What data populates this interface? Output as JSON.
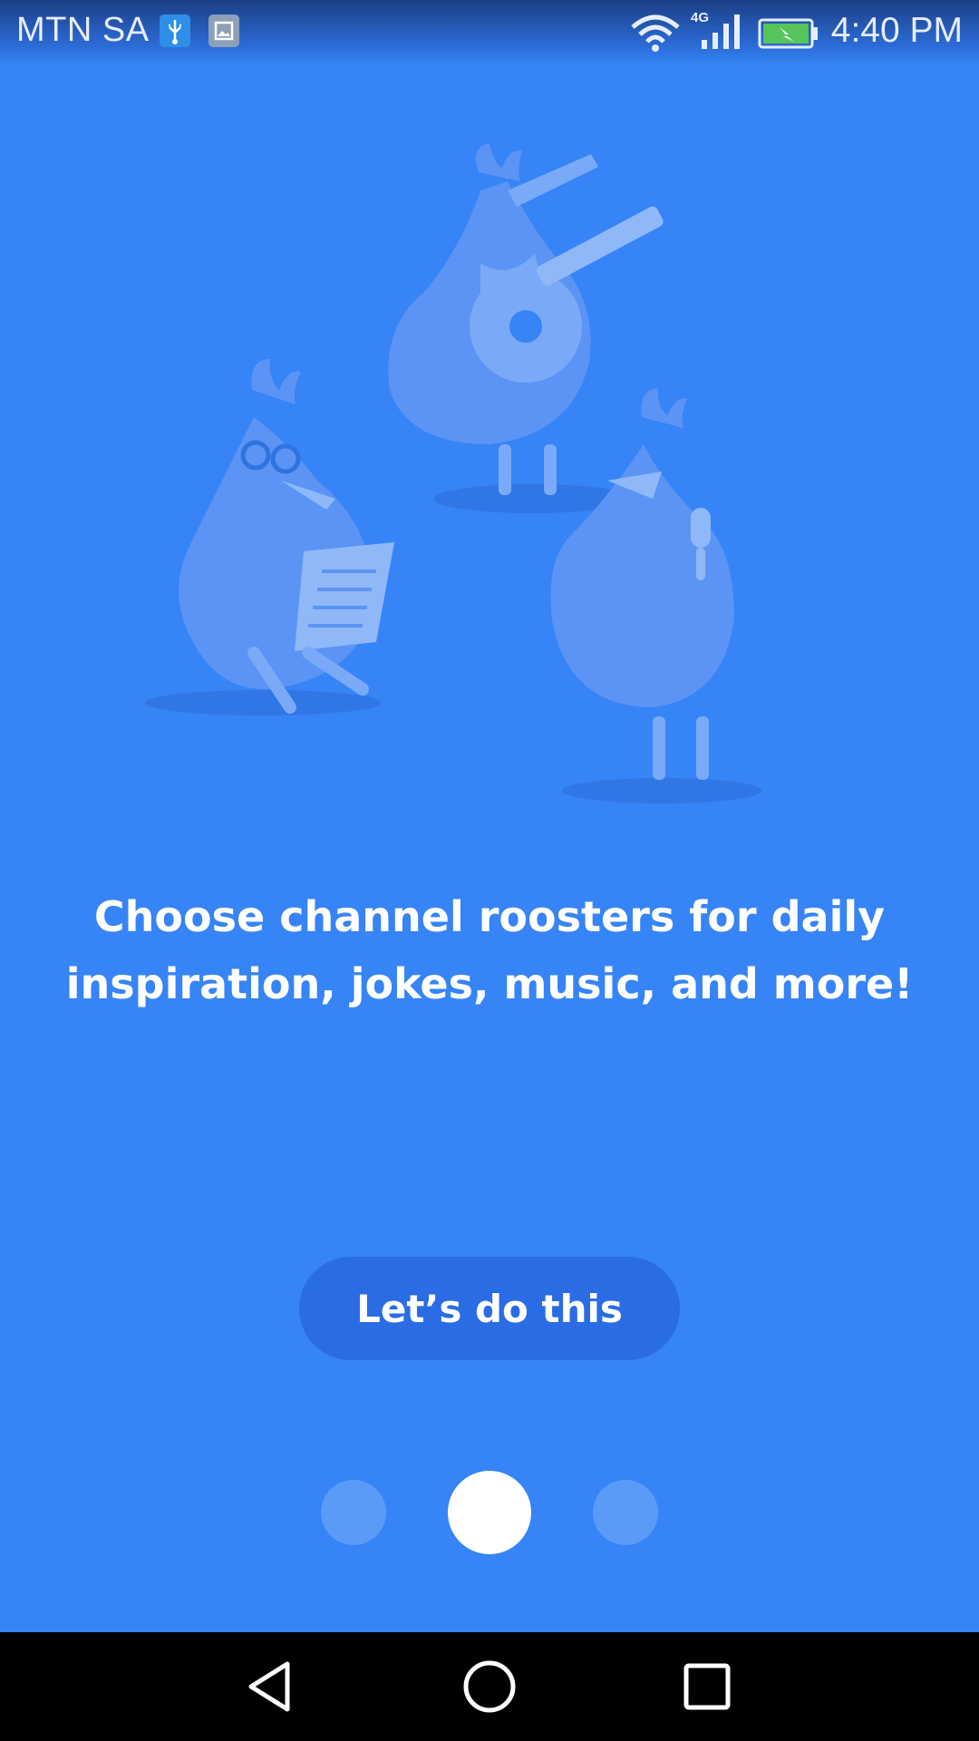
{
  "status_bar": {
    "carrier": "MTN SA",
    "network_type": "4G",
    "time": "4:40 PM",
    "icons": [
      "usb-icon",
      "gallery-icon",
      "wifi-icon",
      "signal-icon",
      "battery-charging-icon"
    ]
  },
  "onboarding": {
    "illustration": "roosters-illustration",
    "headline": "Choose channel roosters for daily inspiration, jokes, music, and more!",
    "cta_label": "Let’s do this",
    "pager": {
      "total": 3,
      "active": 2
    }
  },
  "nav_bar": {
    "icons": [
      "back-icon",
      "home-icon",
      "recent-apps-icon"
    ]
  },
  "colors": {
    "background": "#3684F6",
    "button": "#2A6CE4",
    "dot_inactive": "#5B9BF8",
    "dot_active": "#FFFFFF",
    "text": "#FFFFFF"
  }
}
